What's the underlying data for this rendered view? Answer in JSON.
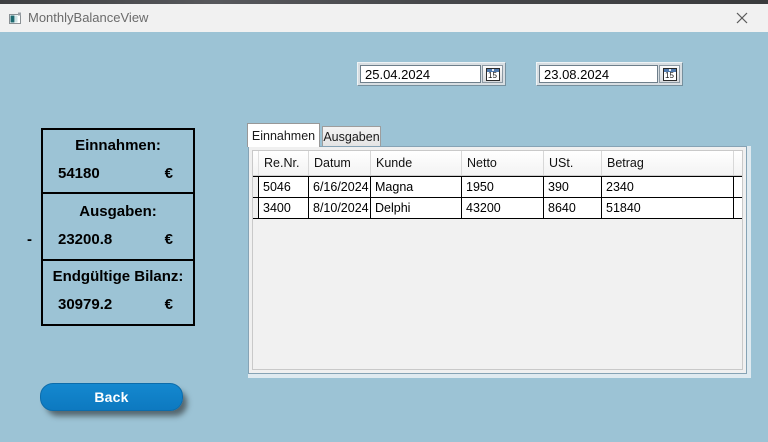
{
  "window": {
    "title": "MonthlyBalanceView"
  },
  "filters": {
    "date_from": "25.04.2024",
    "date_to": "23.08.2024",
    "calendar_day": "15"
  },
  "summary": [
    {
      "label": "Einnahmen:",
      "sign": "",
      "value": "54180",
      "currency": "€"
    },
    {
      "label": "Ausgaben:",
      "sign": "-",
      "value": "23200.8",
      "currency": "€"
    },
    {
      "label": "Endgültige Bilanz:",
      "sign": "",
      "value": "30979.2",
      "currency": "€"
    }
  ],
  "tabs": [
    {
      "label": "Einnahmen",
      "active": true
    },
    {
      "label": "Ausgaben",
      "active": false
    }
  ],
  "grid": {
    "columns": [
      "Re.Nr.",
      "Datum",
      "Kunde",
      "Netto",
      "USt.",
      "Betrag"
    ],
    "rows": [
      [
        "5046",
        "6/16/2024",
        "Magna",
        "1950",
        "390",
        "2340"
      ],
      [
        "3400",
        "8/10/2024",
        "Delphi",
        "43200",
        "8640",
        "51840"
      ]
    ]
  },
  "back_button": {
    "label": "Back"
  },
  "colors": {
    "window_background": "#9cc3d5",
    "titlebar_background": "#f1f1f1",
    "button_blue": "#0f80c6",
    "calendar_band_blue": "#4f79ad",
    "grid_line_black": "#000000",
    "tab_page_border": "#86a3b5"
  }
}
